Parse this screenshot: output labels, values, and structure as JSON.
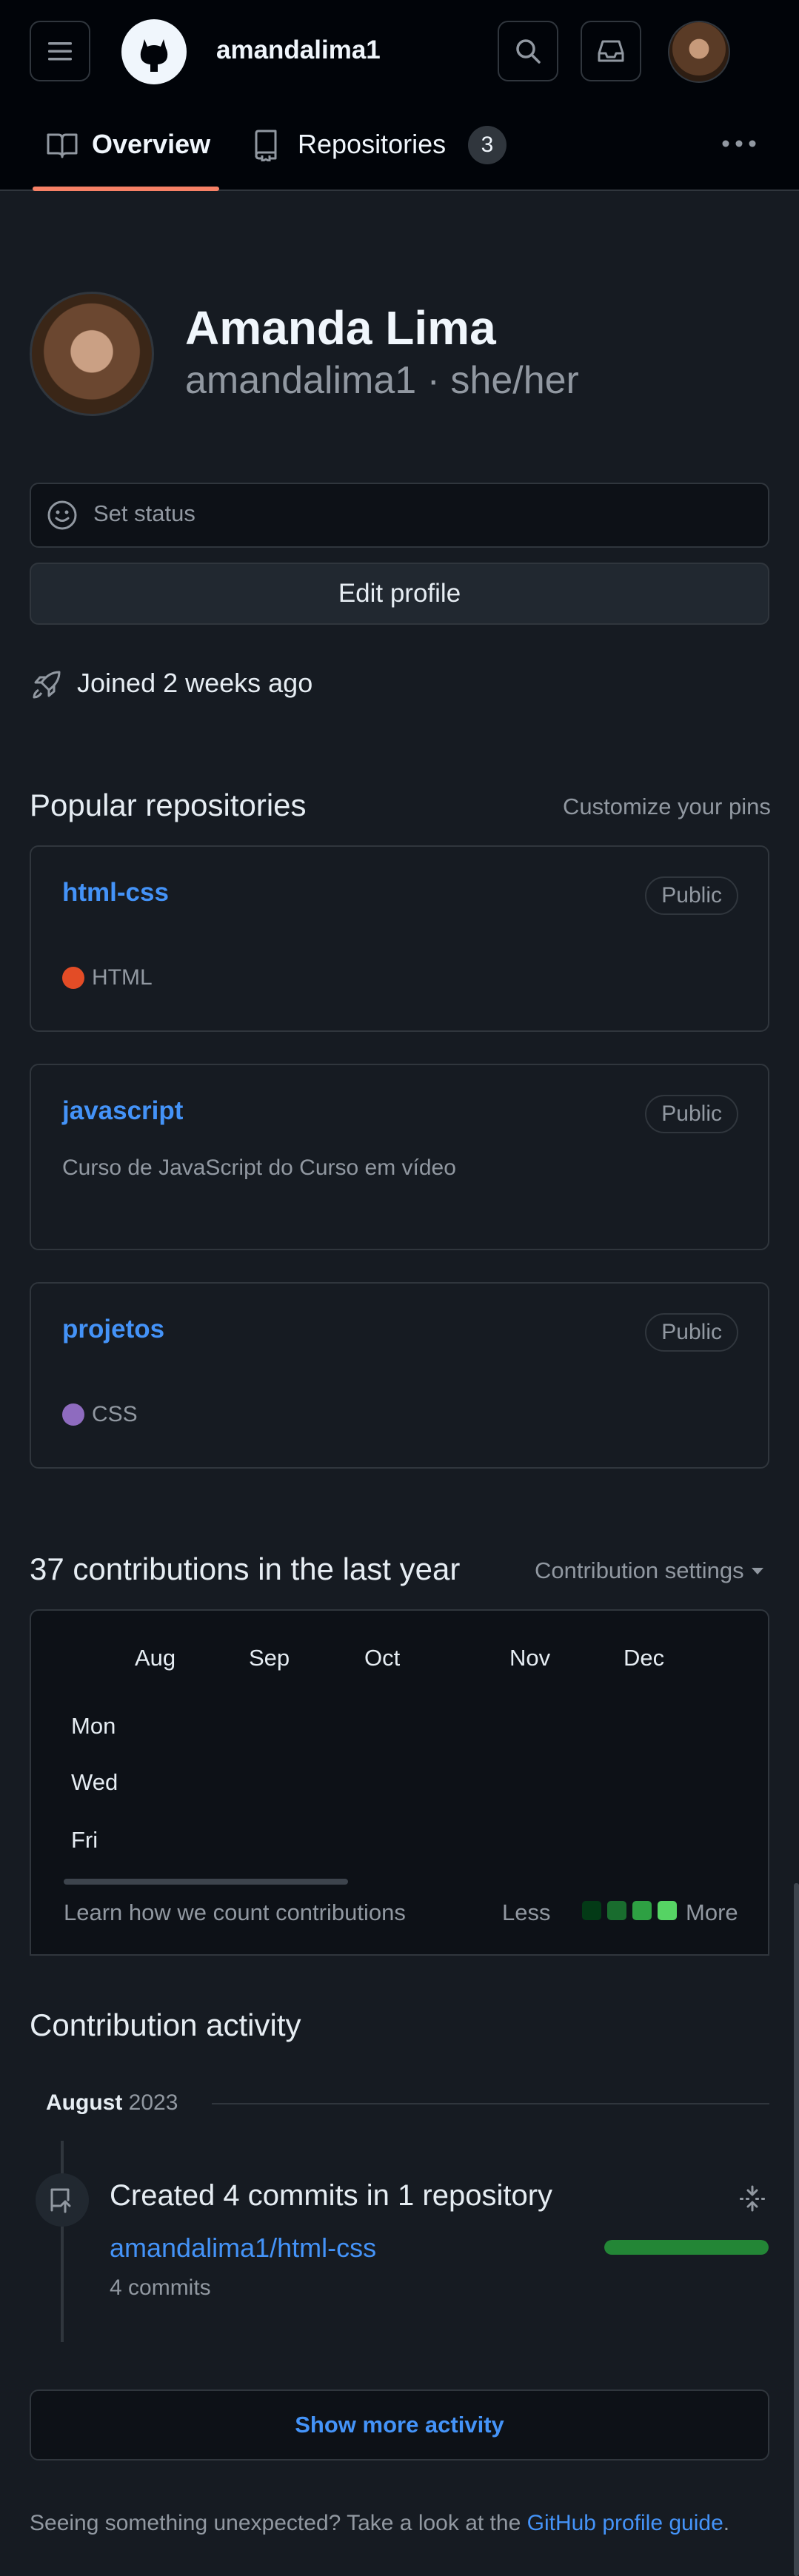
{
  "header": {
    "username": "amandalima1",
    "tabs": [
      {
        "label": "Overview",
        "active": true
      },
      {
        "label": "Repositories",
        "count": "3",
        "active": false
      }
    ]
  },
  "profile": {
    "name": "Amanda Lima",
    "handle": "amandalima1",
    "separator": "·",
    "pronouns": "she/her",
    "set_status": "Set status",
    "edit_profile": "Edit profile",
    "joined": "Joined 2 weeks ago"
  },
  "popular": {
    "title": "Popular repositories",
    "customize": "Customize your pins",
    "repos": [
      {
        "name": "html-css",
        "visibility": "Public",
        "language": "HTML",
        "lang_color": "#e34c26"
      },
      {
        "name": "javascript",
        "visibility": "Public",
        "description": "Curso de JavaScript do Curso em vídeo"
      },
      {
        "name": "projetos",
        "visibility": "Public",
        "language": "CSS",
        "lang_color": "#563d7c"
      }
    ]
  },
  "contributions": {
    "title": "37 contributions in the last year",
    "settings": "Contribution settings",
    "months": [
      "Aug",
      "Sep",
      "Oct",
      "Nov",
      "Dec"
    ],
    "days": [
      "Mon",
      "Wed",
      "Fri"
    ],
    "learn": "Learn how we count contributions",
    "less": "Less",
    "more": "More",
    "legend_colors": [
      "#033a16",
      "#196c2e",
      "#2ea043",
      "#56d364"
    ]
  },
  "activity": {
    "title": "Contribution activity",
    "month": "August",
    "year": "2023",
    "event_title": "Created 4 commits in 1 repository",
    "repo": "amandalima1/html-css",
    "commits": "4 commits",
    "bar_fill": 1.0,
    "show_more": "Show more activity"
  },
  "footer": {
    "text": "Seeing something unexpected? Take a look at the",
    "link": "GitHub profile guide",
    "end": "."
  }
}
